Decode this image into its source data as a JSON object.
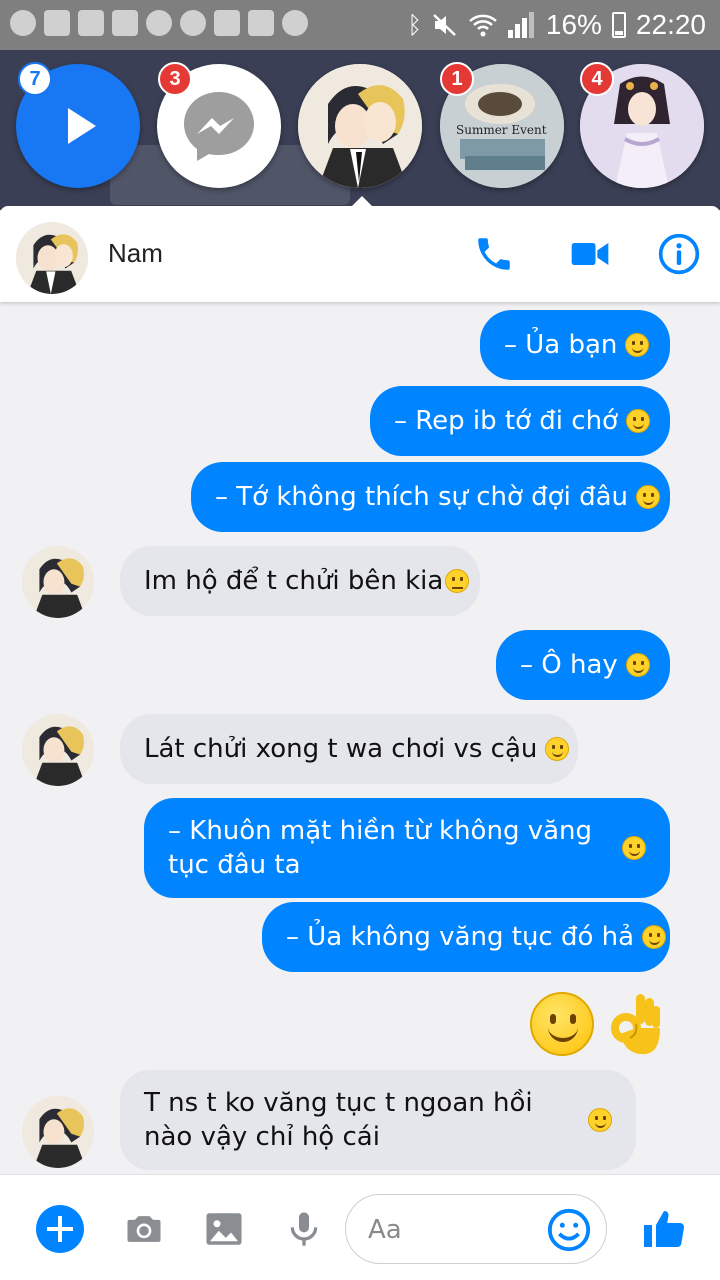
{
  "status_bar": {
    "battery": "16%",
    "time": "22:20",
    "icons": [
      "screenrecord-icon",
      "add-person-icon",
      "facebook-icon",
      "gallery-icon",
      "messenger-icon",
      "messenger-icon",
      "recycle-icon",
      "keyboard-icon",
      "weather-icon",
      "bluetooth-icon",
      "mute-icon",
      "wifi-icon",
      "signal-icon",
      "battery-icon"
    ]
  },
  "chat_heads": [
    {
      "type": "play",
      "badge": "7"
    },
    {
      "type": "messenger",
      "badge": "3"
    },
    {
      "type": "avatar",
      "badge": ""
    },
    {
      "type": "avatar",
      "badge": "1",
      "caption": "Summer Event"
    },
    {
      "type": "avatar",
      "badge": "4"
    }
  ],
  "header": {
    "contact_name": "Nam",
    "icons": [
      "phone-icon",
      "video-icon",
      "info-icon"
    ]
  },
  "messages": [
    {
      "side": "out",
      "text": "– Ủa bạn",
      "emoji": "slight-smile"
    },
    {
      "side": "out",
      "text": "– Rep ib tớ đi chớ",
      "emoji": "slight-smile"
    },
    {
      "side": "out",
      "text": "– Tớ không thích sự chờ đợi đâu",
      "emoji": "slight-smile"
    },
    {
      "side": "in",
      "text": "Im hộ để t chửi bên kia",
      "emoji": "unamused"
    },
    {
      "side": "out",
      "text": "– Ô hay",
      "emoji": "slight-smile"
    },
    {
      "side": "in",
      "text": "Lát chửi xong t wa chơi vs cậu",
      "emoji": "slight-smile"
    },
    {
      "side": "out",
      "text": "– Khuôn mặt hiền từ không văng tục đâu ta",
      "emoji": "slight-smile"
    },
    {
      "side": "out",
      "text": "– Ủa không văng tục đó hả",
      "emoji": "slight-smile"
    },
    {
      "side": "out",
      "text": "",
      "emoji": "big-smile + ok-hand"
    },
    {
      "side": "in",
      "text": "T ns t ko văng tục t ngoan hồi nào vậy chỉ hộ cái",
      "emoji": "slight-smile"
    }
  ],
  "composer": {
    "placeholder": "Aa",
    "icons": [
      "plus-icon",
      "camera-icon",
      "image-icon",
      "microphone-icon",
      "emoji-icon",
      "like-icon"
    ]
  },
  "colors": {
    "accent": "#0084ff",
    "incoming_bubble": "#e4e6eb",
    "badge": "#e53935"
  }
}
